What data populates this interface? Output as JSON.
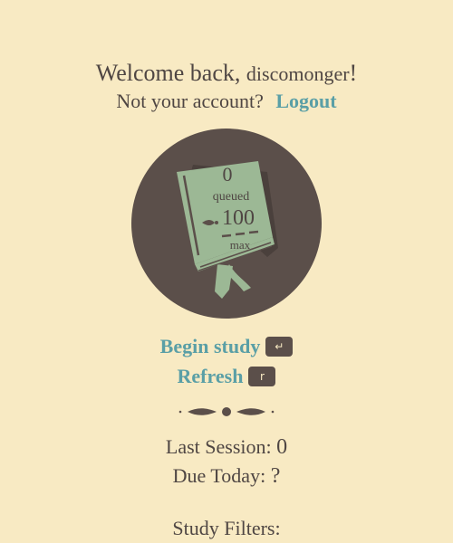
{
  "greeting": {
    "prefix": "Welcome back,",
    "username": "discomonger",
    "suffix": "!"
  },
  "account": {
    "prompt": "Not your account?",
    "logout_label": "Logout"
  },
  "emblem": {
    "queued_count": "0",
    "queued_label": "queued",
    "max_count": "100",
    "max_label": "max"
  },
  "actions": {
    "begin_label": "Begin study",
    "begin_key": "↵",
    "refresh_label": "Refresh",
    "refresh_key": "r"
  },
  "stats": {
    "last_session_label": "Last Session:",
    "last_session_value": "0",
    "due_today_label": "Due Today:",
    "due_today_value": "?"
  },
  "filters": {
    "heading": "Study Filters:"
  },
  "colors": {
    "background": "#f8eac3",
    "text": "#4f4643",
    "link": "#5a9fa6",
    "circle": "#5b4f4a",
    "book": "#9cb895"
  }
}
